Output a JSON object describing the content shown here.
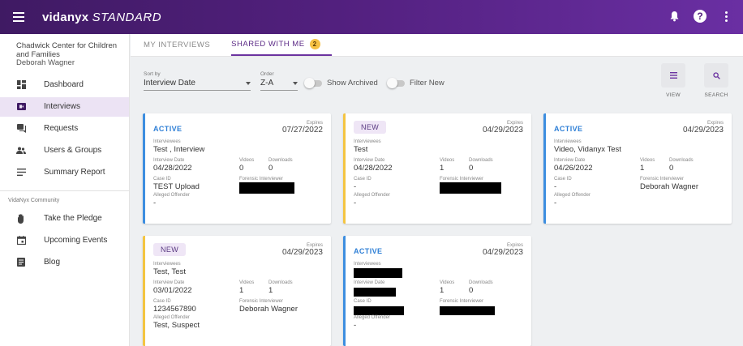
{
  "app": {
    "brand_bold": "vidanyx",
    "brand_edition": "STANDARD"
  },
  "sidebar": {
    "org": "Chadwick Center for Children and Families",
    "user": "Deborah Wagner",
    "items": [
      {
        "label": "Dashboard",
        "icon": "dashboard-icon"
      },
      {
        "label": "Interviews",
        "icon": "interviews-icon"
      },
      {
        "label": "Requests",
        "icon": "requests-icon"
      },
      {
        "label": "Users & Groups",
        "icon": "users-icon"
      },
      {
        "label": "Summary Report",
        "icon": "report-icon"
      }
    ],
    "community_label": "VidaNyx Community",
    "community_items": [
      {
        "label": "Take the Pledge",
        "icon": "pledge-icon"
      },
      {
        "label": "Upcoming Events",
        "icon": "calendar-icon"
      },
      {
        "label": "Blog",
        "icon": "blog-icon"
      }
    ]
  },
  "tabs": {
    "my": "MY INTERVIEWS",
    "shared": "SHARED WITH ME",
    "shared_count": "2"
  },
  "filters": {
    "sort_label": "Sort by",
    "sort_value": "Interview Date",
    "order_label": "Order",
    "order_value": "Z-A",
    "show_archived": "Show Archived",
    "filter_new": "Filter New",
    "view_label": "VIEW",
    "search_label": "SEARCH"
  },
  "field_labels": {
    "expires": "Expires",
    "interviewees": "Interviewees",
    "interview_date": "Interview Date",
    "videos": "Videos",
    "downloads": "Downloads",
    "case_id": "Case ID",
    "forensic_interviewer": "Forensic Interviewer",
    "alleged_offender": "Alleged Offender"
  },
  "cards": [
    {
      "status": "ACTIVE",
      "expires": "07/27/2022",
      "interviewees": "Test , Interview",
      "interview_date": "04/28/2022",
      "videos": "0",
      "downloads": "0",
      "case_id": "TEST Upload",
      "forensic_interviewer": "",
      "alleged_offender": "-"
    },
    {
      "status": "NEW",
      "expires": "04/29/2023",
      "interviewees": "Test",
      "interview_date": "04/28/2022",
      "videos": "1",
      "downloads": "0",
      "case_id": "-",
      "forensic_interviewer": "",
      "alleged_offender": "-"
    },
    {
      "status": "ACTIVE",
      "expires": "04/29/2023",
      "interviewees": "Video, Vidanyx Test",
      "interview_date": "04/26/2022",
      "videos": "1",
      "downloads": "0",
      "case_id": "-",
      "forensic_interviewer": "Deborah Wagner",
      "alleged_offender": "-"
    },
    {
      "status": "NEW",
      "expires": "04/29/2023",
      "interviewees": "Test, Test",
      "interview_date": "03/01/2022",
      "videos": "1",
      "downloads": "1",
      "case_id": "1234567890",
      "forensic_interviewer": "Deborah Wagner",
      "alleged_offender": "Test, Suspect"
    },
    {
      "status": "ACTIVE",
      "expires": "04/29/2023",
      "interviewees": "",
      "interview_date": "",
      "videos": "1",
      "downloads": "0",
      "case_id": "",
      "forensic_interviewer": "",
      "alleged_offender": "-"
    }
  ]
}
